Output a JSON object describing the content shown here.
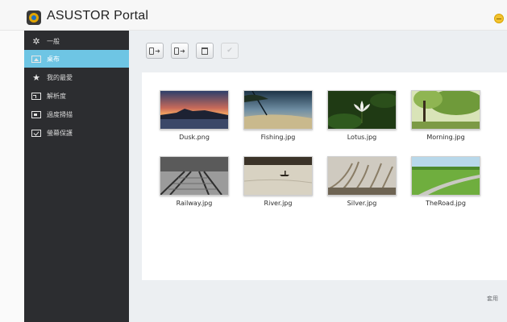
{
  "app": {
    "title": "ASUSTOR Portal"
  },
  "sidebar": {
    "items": [
      {
        "label": "一般",
        "icon": "gear-icon"
      },
      {
        "label": "桌布",
        "icon": "wallpaper-icon",
        "active": true
      },
      {
        "label": "我的最愛",
        "icon": "star-icon"
      },
      {
        "label": "解析度",
        "icon": "resolution-icon"
      },
      {
        "label": "過度掃描",
        "icon": "overscan-icon"
      },
      {
        "label": "螢幕保護",
        "icon": "screensaver-icon"
      }
    ]
  },
  "toolbar": {
    "buttons": [
      {
        "icon": "import-icon"
      },
      {
        "icon": "export-icon"
      },
      {
        "icon": "trash-icon"
      },
      {
        "icon": "checkmark-icon",
        "disabled": true
      }
    ]
  },
  "wallpapers": [
    {
      "name": "Dusk.png",
      "scene": "dusk"
    },
    {
      "name": "Fishing.jpg",
      "scene": "fishing"
    },
    {
      "name": "Lotus.jpg",
      "scene": "lotus"
    },
    {
      "name": "Morning.jpg",
      "scene": "morning"
    },
    {
      "name": "Railway.jpg",
      "scene": "railway"
    },
    {
      "name": "River.jpg",
      "scene": "river"
    },
    {
      "name": "Silver.jpg",
      "scene": "silver"
    },
    {
      "name": "TheRoad.jpg",
      "scene": "road"
    }
  ],
  "footer": {
    "apply_label": "套用"
  }
}
